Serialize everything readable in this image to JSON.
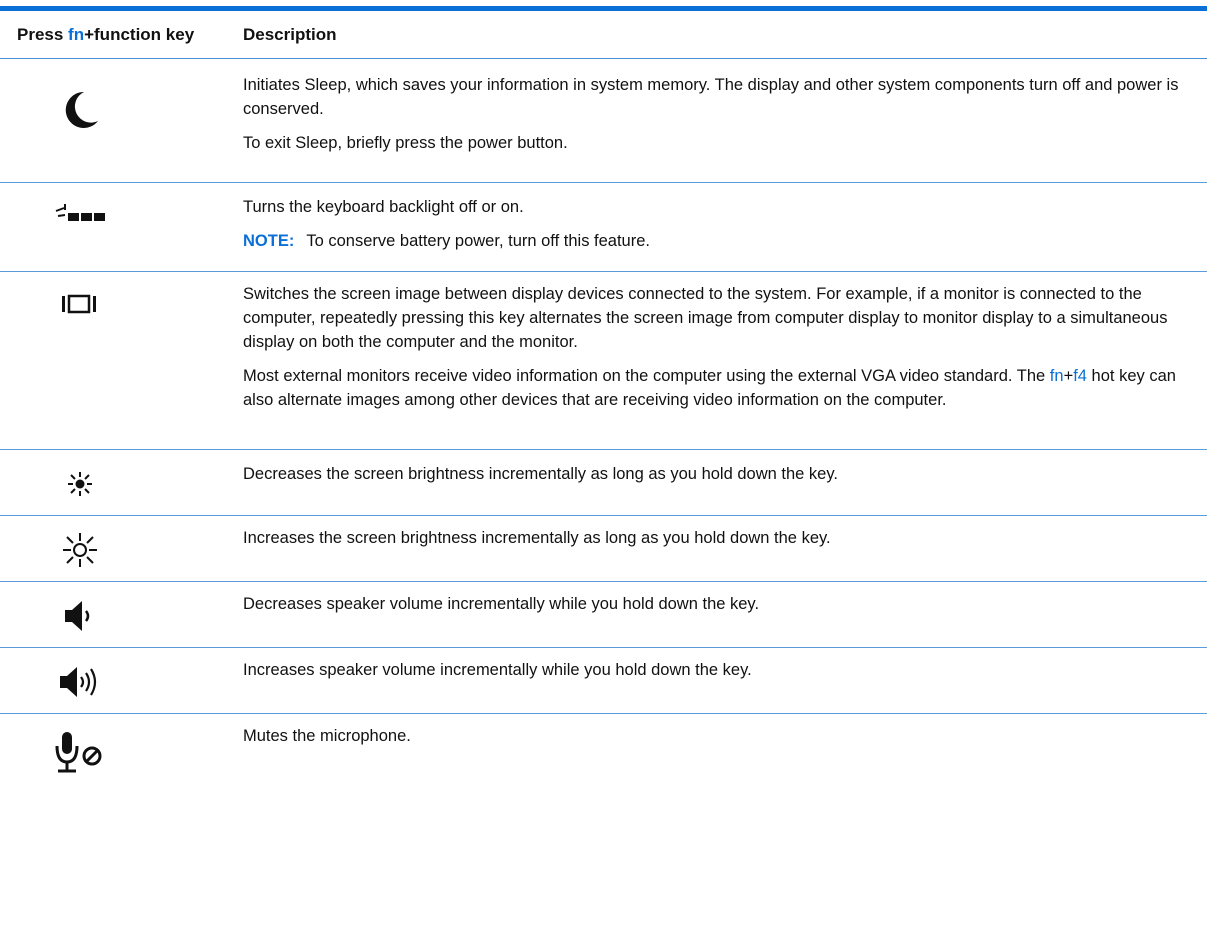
{
  "header": {
    "key_col_prefix": "Press ",
    "key_col_fn": "fn",
    "key_col_suffix": "+function key",
    "desc_col": "Description"
  },
  "rows": [
    {
      "icon": "sleep-moon-icon",
      "paragraphs": [
        "Initiates Sleep, which saves your information in system memory. The display and other system components turn off and power is conserved.",
        "To exit Sleep, briefly press the power button."
      ]
    },
    {
      "icon": "keyboard-backlight-icon",
      "paragraphs": [
        "Turns the keyboard backlight off or on."
      ],
      "note_label": "NOTE:",
      "note_text": "To conserve battery power, turn off this feature."
    },
    {
      "icon": "switch-display-icon",
      "paragraphs": [
        "Switches the screen image between display devices connected to the system. For example, if a monitor is connected to the computer, repeatedly pressing this key alternates the screen image from computer display to monitor display to a simultaneous display on both the computer and the monitor."
      ],
      "p2_before": "Most external monitors receive video information on the computer using the external VGA video standard. The ",
      "p2_fn": "fn",
      "p2_plus": "+",
      "p2_f4": "f4",
      "p2_after": " hot key can also alternate images among other devices that are receiving video information on the computer."
    },
    {
      "icon": "brightness-down-icon",
      "paragraphs": [
        "Decreases the screen brightness incrementally as long as you hold down the key."
      ]
    },
    {
      "icon": "brightness-up-icon",
      "paragraphs": [
        "Increases the screen brightness incrementally as long as you hold down the key."
      ]
    },
    {
      "icon": "volume-down-icon",
      "paragraphs": [
        "Decreases speaker volume incrementally while you hold down the key."
      ]
    },
    {
      "icon": "volume-up-icon",
      "paragraphs": [
        "Increases speaker volume incrementally while you hold down the key."
      ]
    },
    {
      "icon": "microphone-mute-icon",
      "paragraphs": [
        "Mutes the microphone."
      ]
    }
  ],
  "colors": {
    "accent": "#0a6fd6",
    "rule": "#5b9bdc",
    "text": "#111111"
  }
}
